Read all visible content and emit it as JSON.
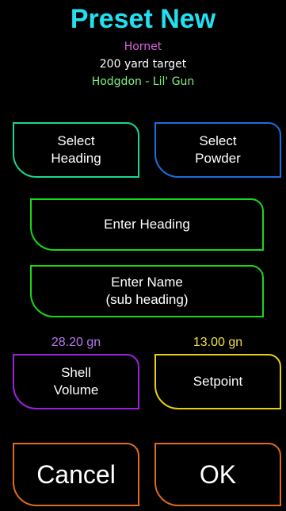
{
  "header": {
    "title": "Preset New",
    "cartridge": "Hornet",
    "target": "200 yard target",
    "powder": "Hodgdon - Lil' Gun"
  },
  "buttons": {
    "select_heading": "Select\nHeading",
    "select_powder": "Select\nPowder",
    "enter_heading": "Enter Heading",
    "enter_name": "Enter Name\n(sub heading)",
    "shell_volume": "Shell\nVolume",
    "setpoint": "Setpoint",
    "cancel": "Cancel",
    "ok": "OK"
  },
  "values": {
    "shell_volume": "28.20 gn",
    "setpoint": "13.00 gn"
  },
  "colors": {
    "title": "#22e0f0",
    "cartridge": "#e060e0",
    "target": "#ffffff",
    "powder": "#80f080",
    "select_heading": "#18d890",
    "select_powder": "#1a6fe0",
    "enter_buttons": "#18d818",
    "shell_volume_border": "#a020e0",
    "shell_volume_value": "#b878f0",
    "setpoint_border": "#e8d010",
    "setpoint_value": "#f0e040",
    "cancel_ok": "#e06a18"
  }
}
